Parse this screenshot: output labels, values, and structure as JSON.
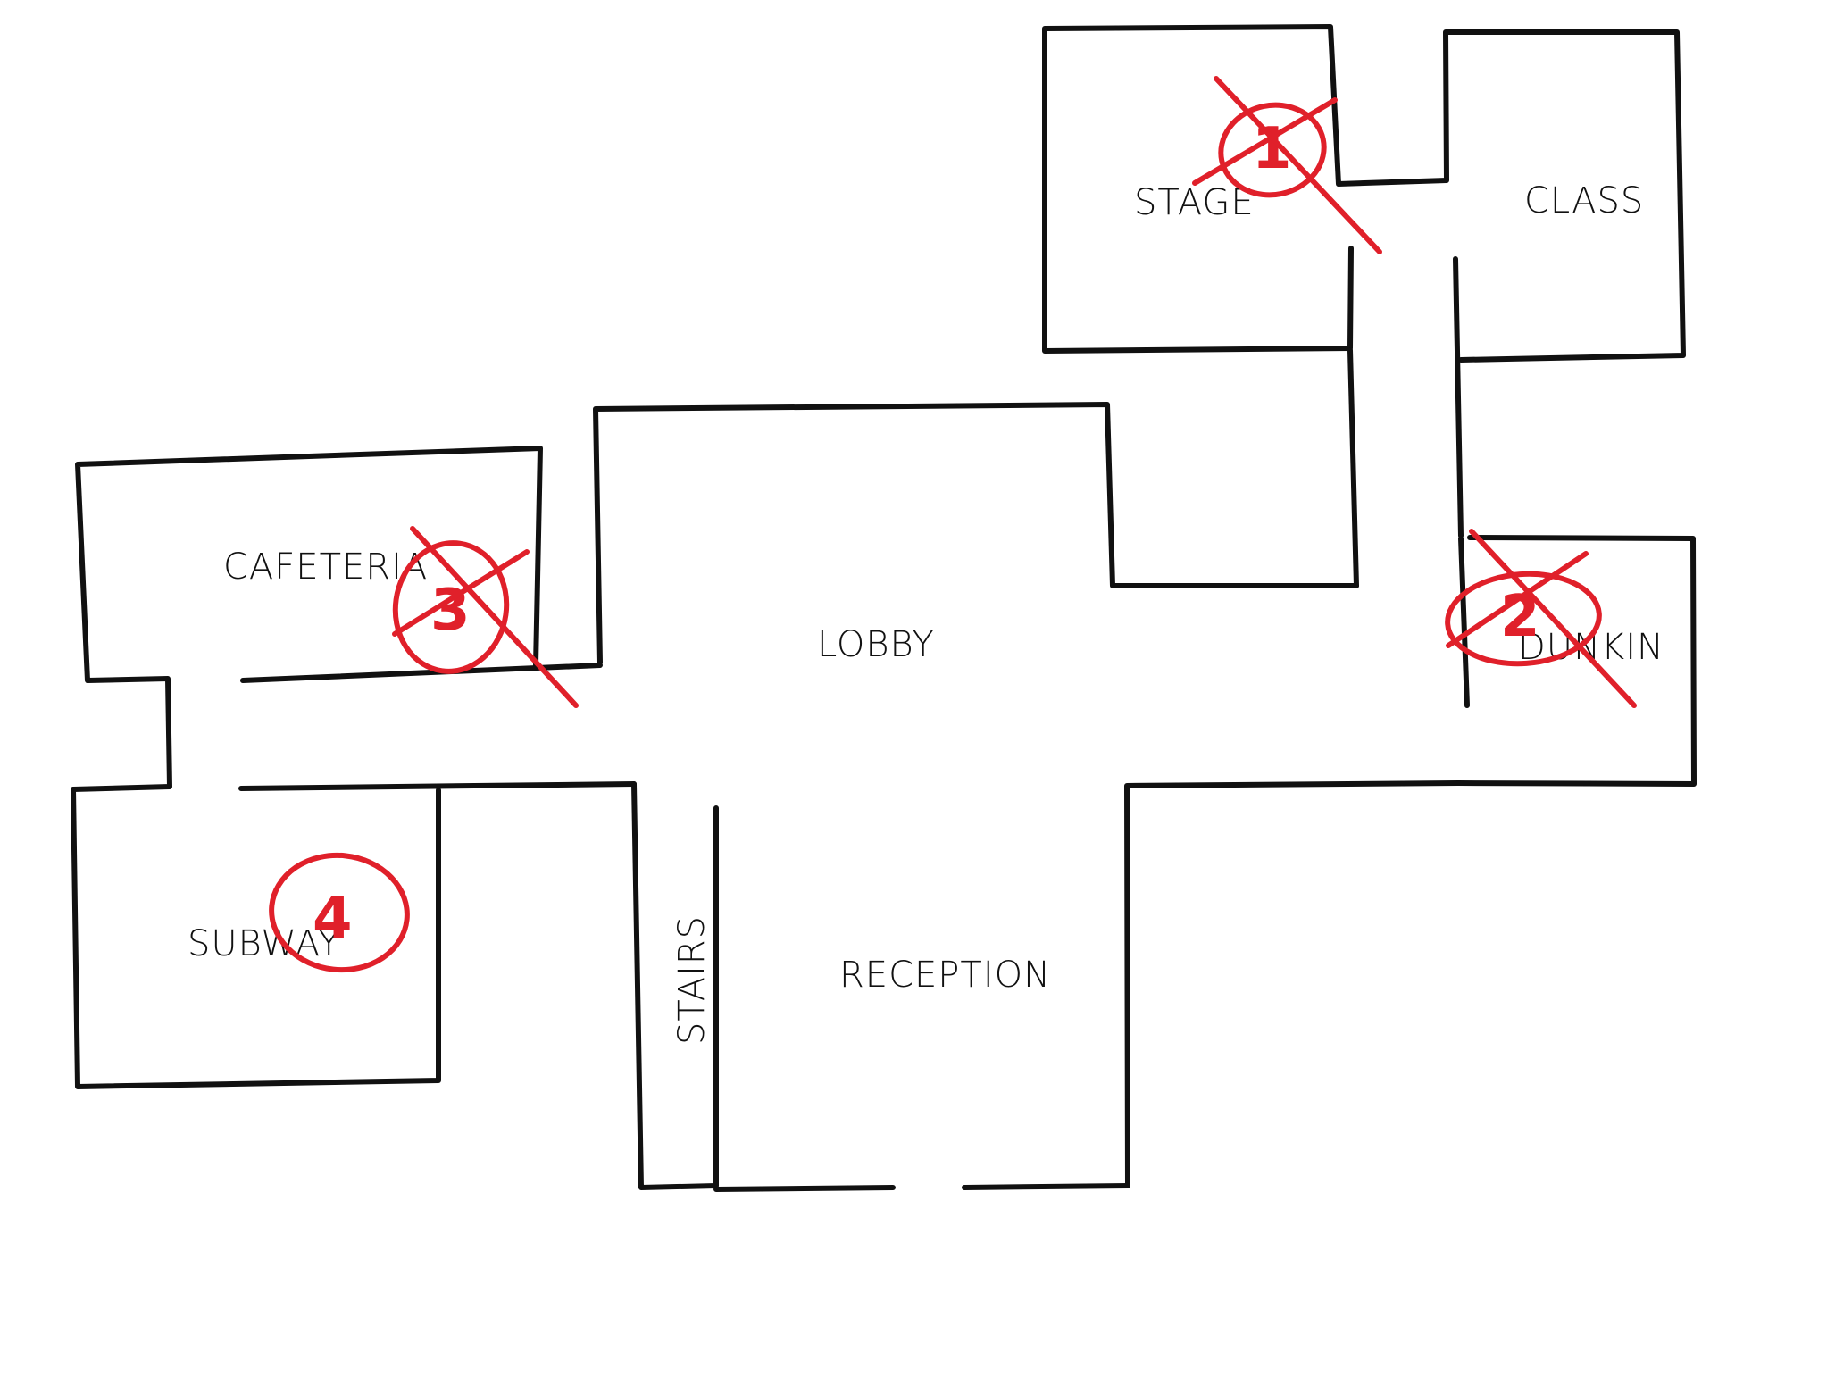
{
  "map": {
    "rooms": {
      "stage": "STAGE",
      "class": "CLASS",
      "cafeteria": "CAFETERIA",
      "lobby": "LOBBY",
      "dunkin": "DUNKIN",
      "subway": "SUBWAY",
      "stairs": "STAIRS",
      "reception": "RECEPTION"
    },
    "markers": {
      "stage": {
        "number": "1",
        "crossed": true
      },
      "dunkin": {
        "number": "2",
        "crossed": true
      },
      "cafeteria": {
        "number": "3",
        "crossed": true
      },
      "subway": {
        "number": "4",
        "crossed": false
      }
    },
    "colors": {
      "wall": "#111111",
      "marker": "#e0202a"
    }
  }
}
